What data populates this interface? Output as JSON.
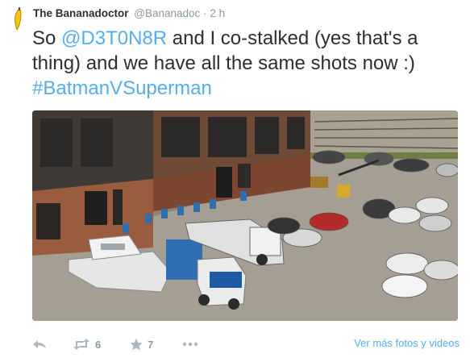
{
  "tweet": {
    "author_name": "The Bananadoctor",
    "author_handle": "@Bananadoc",
    "separator": "·",
    "time": "2 h",
    "text_part1": "So ",
    "mention": "@D3T0N8R",
    "text_part2": " and I co-stalked (yes that's a thing)  and we have all the same shots now :) ",
    "hashtag": "#BatmanVSuperman"
  },
  "actions": {
    "retweet_count": "6",
    "favorite_count": "7",
    "more_photos_label": "Ver más fotos y videos"
  },
  "colors": {
    "link": "#55acee",
    "meta": "#8899a6",
    "text": "#292f33"
  },
  "icons": {
    "avatar": "banana-avatar",
    "reply": "reply-icon",
    "retweet": "retweet-icon",
    "favorite": "star-icon",
    "more": "more-dots-icon"
  }
}
